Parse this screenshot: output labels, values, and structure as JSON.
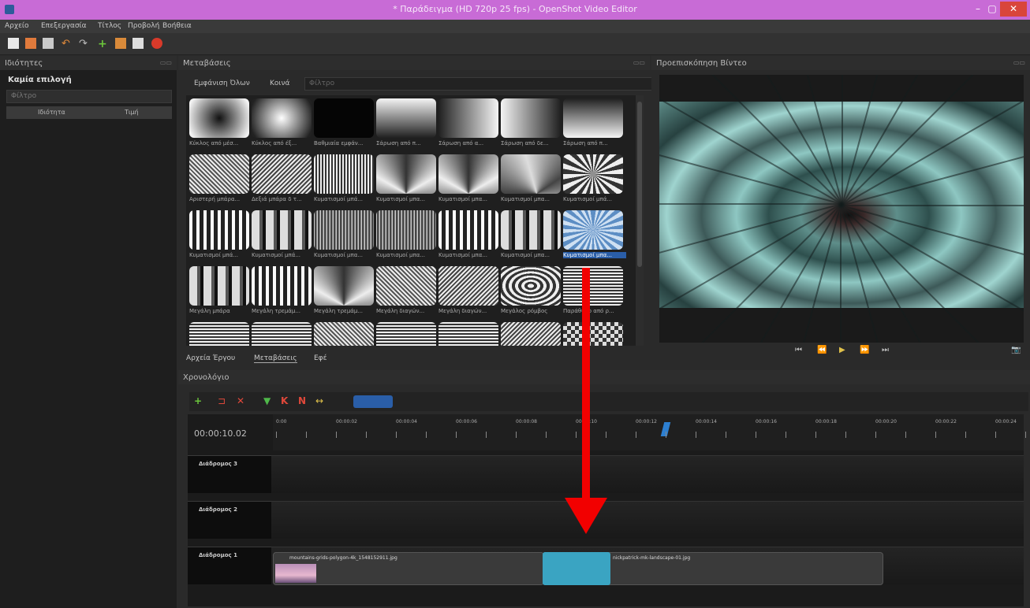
{
  "window": {
    "title": "* Παράδειγμα (HD 720p 25 fps) - OpenShot Video Editor",
    "minimize": "–",
    "maximize": "▢",
    "close": "✕"
  },
  "menu": [
    "Αρχείο",
    "Επεξεργασία",
    "Τίτλος",
    "Προβολή",
    "Βοήθεια"
  ],
  "properties": {
    "header": "Ιδιότητες",
    "selection": "Καμία επιλογή",
    "filter_placeholder": "Φίλτρο",
    "col_property": "Ιδιότητα",
    "col_value": "Τιμή"
  },
  "transitions": {
    "header": "Μεταβάσεις",
    "filter_all": "Εμφάνιση Όλων",
    "filter_common": "Κοινά",
    "filter_placeholder": "Φίλτρο",
    "tiles": [
      {
        "label": "Κύκλος από μέσ...",
        "style": "radial-dark"
      },
      {
        "label": "Κύκλος από έξ...",
        "style": "radial-light"
      },
      {
        "label": "Βαθμιαία εμφάν...",
        "style": "black"
      },
      {
        "label": "Σάρωση από π...",
        "style": "v-grad"
      },
      {
        "label": "Σάρωση από α...",
        "style": "h-grad"
      },
      {
        "label": "Σάρωση από δε...",
        "style": "h-grad-rev"
      },
      {
        "label": "Σάρωση από π...",
        "style": "v-grad-rev"
      },
      {
        "label": "Αριστερή μπάρα...",
        "style": "diag"
      },
      {
        "label": "Δεξιά μπάρα δ τ...",
        "style": "diag2"
      },
      {
        "label": "Κυματισμοί μπά...",
        "style": "vstripes"
      },
      {
        "label": "Κυματισμοί μπα...",
        "style": "fan"
      },
      {
        "label": "Κυματισμοί μπα...",
        "style": "fan"
      },
      {
        "label": "Κυματισμοί μπα...",
        "style": "fan2"
      },
      {
        "label": "Κυματισμοί μπά...",
        "style": "burst"
      },
      {
        "label": "Κυματισμοί μπά...",
        "style": "vbars"
      },
      {
        "label": "Κυματισμοί μπά...",
        "style": "vbars2"
      },
      {
        "label": "Κυματισμοί μπα...",
        "style": "noise"
      },
      {
        "label": "Κυματισμοί μπα...",
        "style": "noise"
      },
      {
        "label": "Κυματισμοί μπα...",
        "style": "vbars"
      },
      {
        "label": "Κυματισμοί μπα...",
        "style": "vbars2"
      },
      {
        "label": "Κυματισμοί μπα...",
        "style": "blue"
      },
      {
        "label": "Μεγάλη μπάρα",
        "style": "vbars2"
      },
      {
        "label": "Μεγάλη τρεμάμ...",
        "style": "vbars"
      },
      {
        "label": "Μεγάλη τρεμάμ...",
        "style": "fan"
      },
      {
        "label": "Μεγάλη διαγών...",
        "style": "diag"
      },
      {
        "label": "Μεγάλη διαγών...",
        "style": "diag2"
      },
      {
        "label": "Μεγάλος ρόμβος",
        "style": "diamond"
      },
      {
        "label": "Παράθυρο από ρ...",
        "style": "hstripes"
      },
      {
        "label": "",
        "style": "hstripes"
      },
      {
        "label": "",
        "style": "hstripes"
      },
      {
        "label": "",
        "style": "diag"
      },
      {
        "label": "",
        "style": "hstripes"
      },
      {
        "label": "",
        "style": "hstripes"
      },
      {
        "label": "",
        "style": "diag2"
      },
      {
        "label": "",
        "style": "checker"
      }
    ],
    "selected_index": 20
  },
  "bottom_tabs": [
    "Αρχεία Έργου",
    "Μεταβάσεις",
    "Εφέ"
  ],
  "preview": {
    "header": "Προεπισκόπηση Βίντεο",
    "controls": [
      "⏮",
      "⏪",
      "▶",
      "⏩",
      "⏭"
    ],
    "camera_icon": "📷"
  },
  "timeline": {
    "header": "Χρονολόγιο",
    "timecode": "00:00:10.02",
    "ticks": [
      "0:00",
      "00:00:02",
      "00:00:04",
      "00:00:06",
      "00:00:08",
      "00:00:10",
      "00:00:12",
      "00:00:14",
      "00:00:16",
      "00:00:18",
      "00:00:20",
      "00:00:22",
      "00:00:24"
    ],
    "tracks": [
      {
        "name": "Διάδρομος 3"
      },
      {
        "name": "Διάδρομος 2"
      },
      {
        "name": "Διάδρομος 1"
      }
    ],
    "clip1": "mountains-grids-polygon-4k_1548152911.jpg",
    "clip2": "nickpatrick-mk-landscape-01.jpg"
  },
  "colors": {
    "titlebar": "#c86bd6",
    "accent": "#2a5ea8",
    "transition_clip": "#3aa4c2",
    "arrow": "#f20000"
  }
}
